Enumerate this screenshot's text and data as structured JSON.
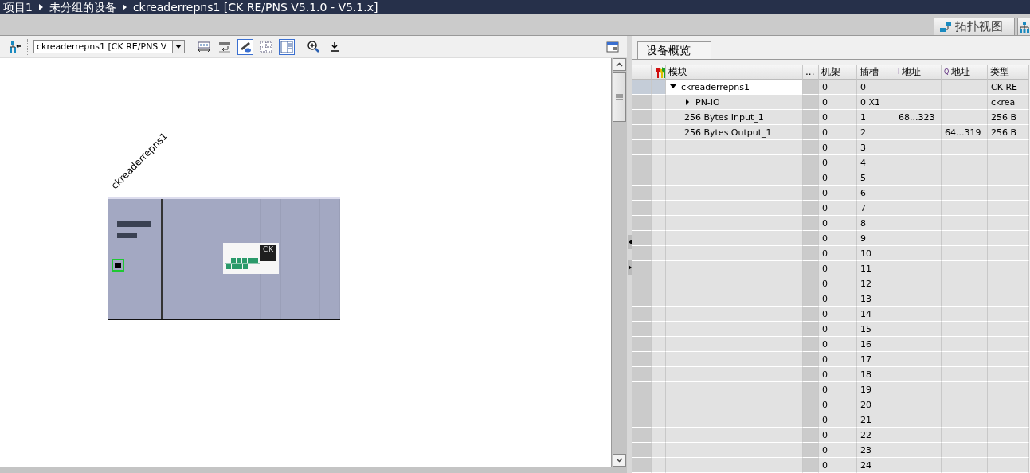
{
  "breadcrumb": [
    "项目1",
    "未分组的设备",
    "ckreaderrepns1 [CK RE/PNS V5.1.0 - V5.1.x]"
  ],
  "view_tabs": [
    {
      "label": "拓扑视图"
    }
  ],
  "toolbar": {
    "device_select": "ckreaderrepns1 [CK RE/PNS V"
  },
  "canvas": {
    "device_label": "ckreaderrepns1",
    "module_logo": "CK"
  },
  "overview": {
    "tab": "设备概览",
    "columns": [
      {
        "label": "模块"
      },
      {
        "label": "..."
      },
      {
        "label": "机架"
      },
      {
        "label": "插槽"
      },
      {
        "prefix": "I",
        "label": "地址"
      },
      {
        "prefix": "Q",
        "label": "地址"
      },
      {
        "label": "类型"
      }
    ],
    "tree": [
      {
        "module": "ckreaderrepns1",
        "rack": "0",
        "slot": "0",
        "type": "CK RE",
        "expanded": true,
        "selected": true,
        "children": [
          {
            "module": "PN-IO",
            "rack": "0",
            "slot": "0 X1",
            "type": "ckrea",
            "expanded": false,
            "selected": false
          },
          {
            "module": "256 Bytes Input_1",
            "rack": "0",
            "slot": "1",
            "i_address": "68...323",
            "type": "256 B",
            "selected": false
          },
          {
            "module": "256 Bytes Output_1",
            "rack": "0",
            "slot": "2",
            "q_address": "64...319",
            "type": "256 B",
            "selected": false
          }
        ]
      }
    ],
    "empty_slots": [
      {
        "rack": "0",
        "slot": "3"
      },
      {
        "rack": "0",
        "slot": "4"
      },
      {
        "rack": "0",
        "slot": "5"
      },
      {
        "rack": "0",
        "slot": "6"
      },
      {
        "rack": "0",
        "slot": "7"
      },
      {
        "rack": "0",
        "slot": "8"
      },
      {
        "rack": "0",
        "slot": "9"
      },
      {
        "rack": "0",
        "slot": "10"
      },
      {
        "rack": "0",
        "slot": "11"
      },
      {
        "rack": "0",
        "slot": "12"
      },
      {
        "rack": "0",
        "slot": "13"
      },
      {
        "rack": "0",
        "slot": "14"
      },
      {
        "rack": "0",
        "slot": "15"
      },
      {
        "rack": "0",
        "slot": "16"
      },
      {
        "rack": "0",
        "slot": "17"
      },
      {
        "rack": "0",
        "slot": "18"
      },
      {
        "rack": "0",
        "slot": "19"
      },
      {
        "rack": "0",
        "slot": "20"
      },
      {
        "rack": "0",
        "slot": "21"
      },
      {
        "rack": "0",
        "slot": "22"
      },
      {
        "rack": "0",
        "slot": "23"
      },
      {
        "rack": "0",
        "slot": "24"
      }
    ]
  }
}
